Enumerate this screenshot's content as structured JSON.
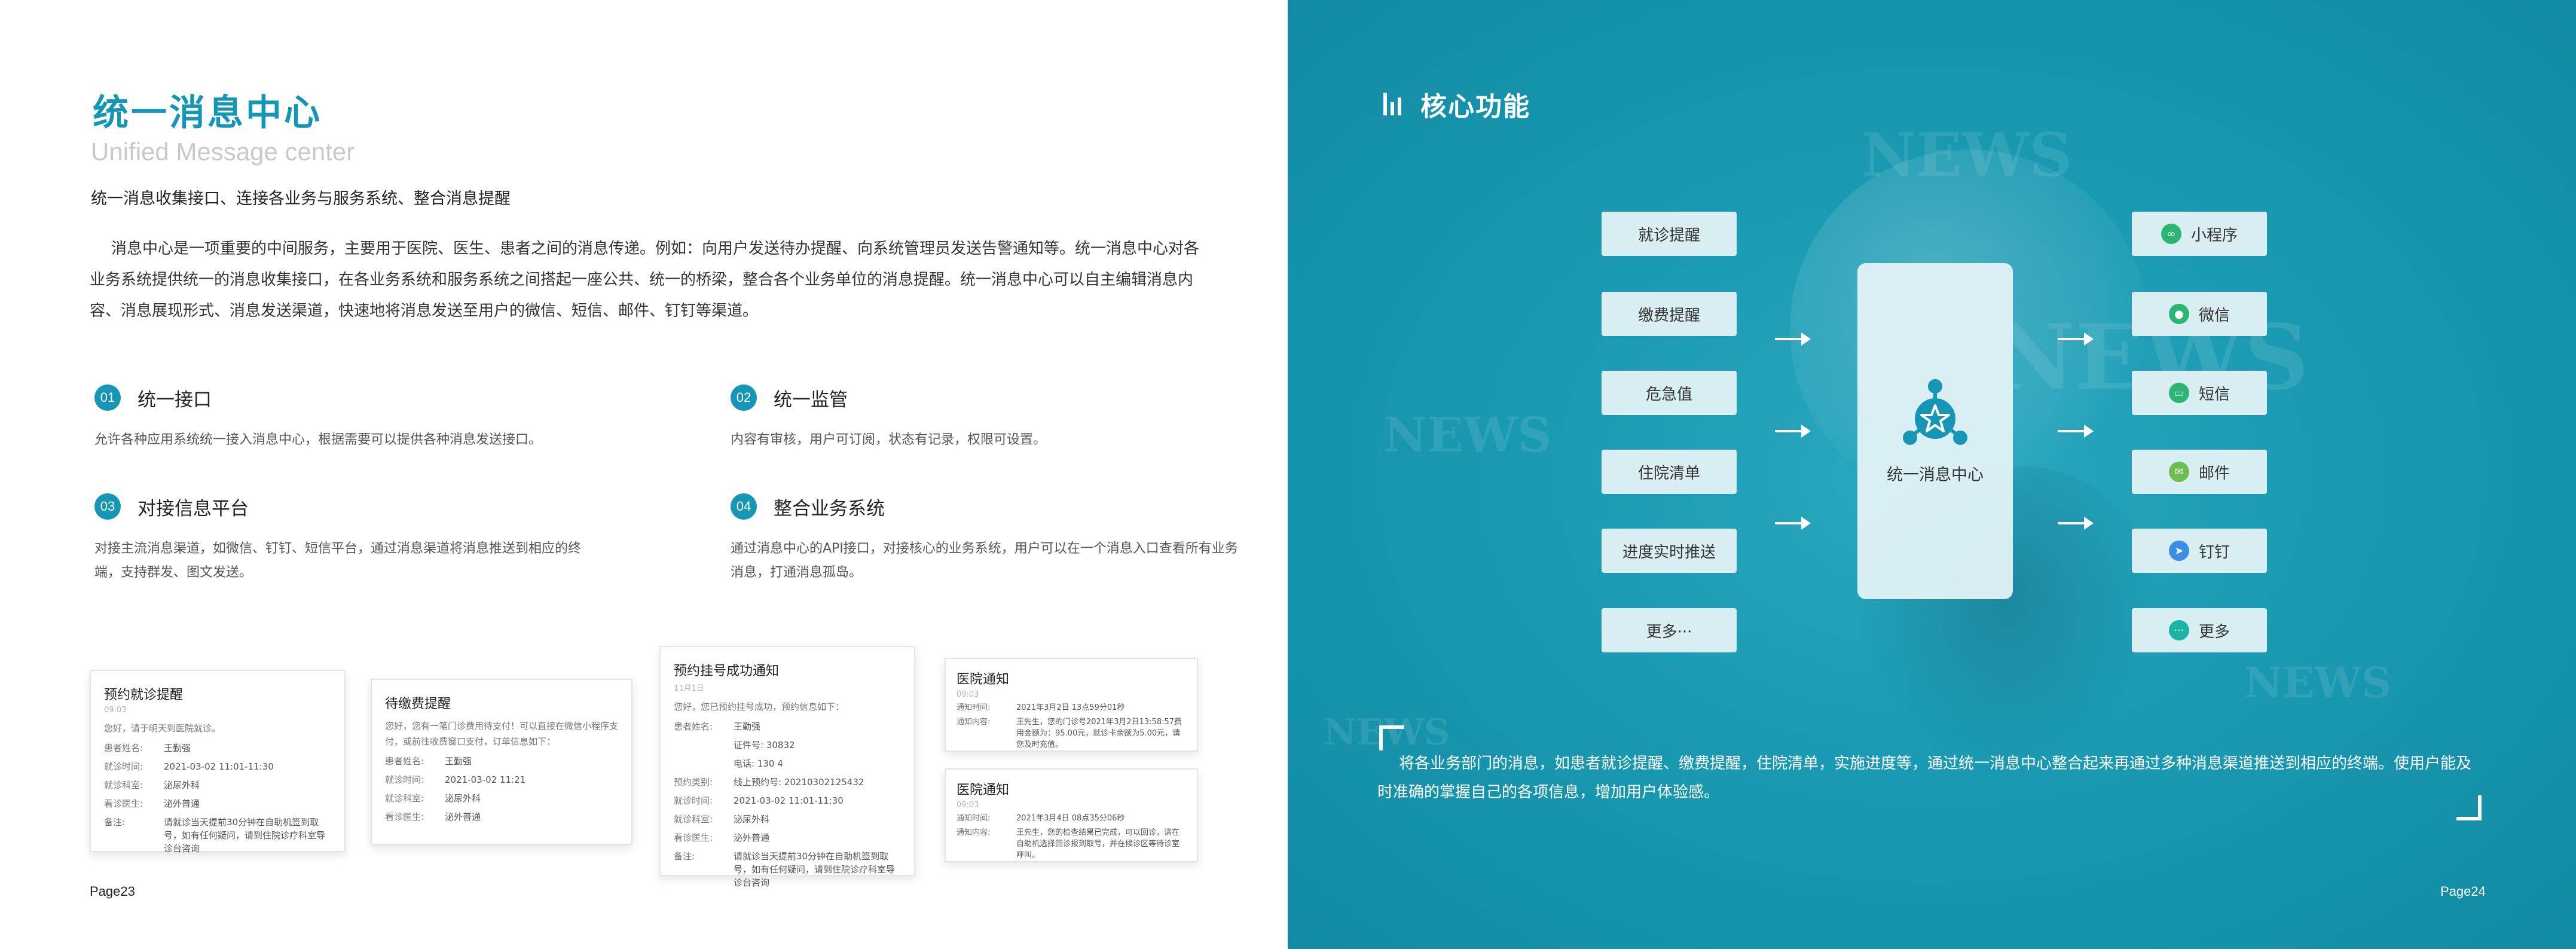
{
  "left": {
    "title_cn": "统一消息中心",
    "title_en": "Unified Message center",
    "subtitle": "统一消息收集接口、连接各业务与服务系统、整合消息提醒",
    "intro": "消息中心是一项重要的中间服务，主要用于医院、医生、患者之间的消息传递。例如：向用户发送待办提醒、向系统管理员发送告警通知等。统一消息中心对各业务系统提供统一的消息收集接口，在各业务系统和服务系统之间搭起一座公共、统一的桥梁，整合各个业务单位的消息提醒。统一消息中心可以自主编辑消息内容、消息展现形式、消息发送渠道，快速地将消息发送至用户的微信、短信、邮件、钉钉等渠道。",
    "features": [
      {
        "num": "01",
        "title": "统一接口",
        "desc": "允许各种应用系统统一接入消息中心，根据需要可以提供各种消息发送接口。"
      },
      {
        "num": "02",
        "title": "统一监管",
        "desc": "内容有审核，用户可订阅，状态有记录，权限可设置。"
      },
      {
        "num": "03",
        "title": "对接信息平台",
        "desc": "对接主流消息渠道，如微信、钉钉、短信平台，通过消息渠道将消息推送到相应的终端，支持群发、图文发送。"
      },
      {
        "num": "04",
        "title": "整合业务系统",
        "desc": "通过消息中心的API接口，对接核心的业务系统，用户可以在一个消息入口查看所有业务消息，打通消息孤岛。"
      }
    ],
    "cards": [
      {
        "title": "预约就诊提醒",
        "sub": "09:03",
        "greet": "您好，请于明天到医院就诊。",
        "rows": [
          {
            "k": "患者姓名:",
            "v": "王勤强"
          },
          {
            "k": "就诊时间:",
            "v": "2021-03-02 11:01-11:30"
          },
          {
            "k": "就诊科室:",
            "v": "泌尿外科"
          },
          {
            "k": "看诊医生:",
            "v": "泌外普通"
          },
          {
            "k": "备注:",
            "v": "请就诊当天提前30分钟在自助机签到取号，如有任何疑问，请到住院诊疗科室导诊台咨询"
          }
        ]
      },
      {
        "title": "待缴费提醒",
        "greet": "您好，您有一笔门诊费用待支付！可以直接在微信小程序支付，或前往收费窗口支付，订单信息如下：",
        "rows": [
          {
            "k": "患者姓名:",
            "v": "王勤强"
          },
          {
            "k": "就诊时间:",
            "v": "2021-03-02 11:21"
          },
          {
            "k": "就诊科室:",
            "v": "泌尿外科"
          },
          {
            "k": "看诊医生:",
            "v": "泌外普通"
          }
        ]
      },
      {
        "title": "预约挂号成功通知",
        "sub": "11月1日",
        "greet": "您好，您已预约挂号成功，预约信息如下：",
        "rows": [
          {
            "k": "患者姓名:",
            "v": "王勤强"
          },
          {
            "k": "",
            "v": "证件号:            30832"
          },
          {
            "k": "",
            "v": "电话: 130            4"
          },
          {
            "k": "预约类别:",
            "v": "线上预约号: 20210302125432"
          },
          {
            "k": "就诊时间:",
            "v": "2021-03-02 11:01-11:30"
          },
          {
            "k": "就诊科室:",
            "v": "泌尿外科"
          },
          {
            "k": "看诊医生:",
            "v": "泌外普通"
          },
          {
            "k": "备注:",
            "v": "请就诊当天提前30分钟在自助机签到取号，如有任何疑问，请到住院诊疗科室导诊台咨询"
          }
        ]
      },
      {
        "title": "医院通知",
        "sub": "09:03",
        "rows": [
          {
            "k": "通知时间:",
            "v": "2021年3月2日 13点59分01秒"
          },
          {
            "k": "通知内容:",
            "v": "王先生，您的门诊号2021年3月2日13:58:57费用金额为：95.00元，就诊卡余额为5.00元，请您及时充值。"
          }
        ]
      },
      {
        "title": "医院通知",
        "sub": "09:03",
        "rows": [
          {
            "k": "通知时间:",
            "v": "2021年3月4日 08点35分06秒"
          },
          {
            "k": "通知内容:",
            "v": "王先生，您的检查结果已完成，可以回诊，请在自助机选择回诊报到取号，并在候诊区等待诊室呼叫。"
          }
        ]
      }
    ],
    "page_num": "Page23"
  },
  "right": {
    "heading": "核心功能",
    "sources": [
      "就诊提醒",
      "缴费提醒",
      "危急值",
      "住院清单",
      "进度实时推送",
      "更多···"
    ],
    "hub_label": "统一消息中心",
    "destinations": [
      {
        "label": "小程序",
        "icon": "mini-program-icon",
        "color": "#2bb673"
      },
      {
        "label": "微信",
        "icon": "wechat-icon",
        "color": "#2bb673"
      },
      {
        "label": "短信",
        "icon": "sms-icon",
        "color": "#2bb673"
      },
      {
        "label": "邮件",
        "icon": "mail-icon",
        "color": "#6bbf4e"
      },
      {
        "label": "钉钉",
        "icon": "dingtalk-icon",
        "color": "#3a8ee6"
      },
      {
        "label": "更多",
        "icon": "more-icon",
        "color": "#1bb5a8"
      }
    ],
    "summary": "将各业务部门的消息，如患者就诊提醒、缴费提醒，住院清单，实施进度等，通过统一消息中心整合起来再通过多种消息渠道推送到相应的终端。使用户能及时准确的掌握自己的各项信息，增加用户体验感。",
    "page_num": "Page24",
    "accent": "#1596b4"
  }
}
